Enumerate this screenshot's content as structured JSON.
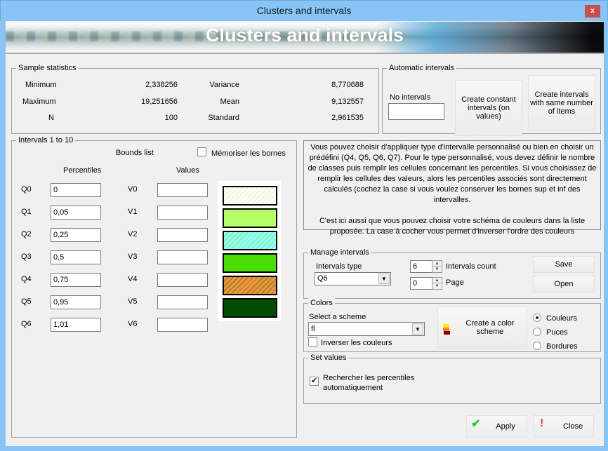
{
  "window": {
    "title": "Clusters and intervals",
    "close_label": "x"
  },
  "banner": {
    "title": "Clusters and intervals"
  },
  "sample_statistics": {
    "legend": "Sample statistics",
    "minimum": {
      "label": "Minimum",
      "value": "2,338256"
    },
    "maximum": {
      "label": "Maximum",
      "value": "19,251656"
    },
    "n": {
      "label": "N",
      "value": "100"
    },
    "variance": {
      "label": "Variance",
      "value": "8,770688"
    },
    "mean": {
      "label": "Mean",
      "value": "9,132557"
    },
    "standard": {
      "label": "Standard",
      "value": "2,961535"
    }
  },
  "automatic_intervals": {
    "legend": "Automatic intervals",
    "no_intervals_label": "No intervals",
    "no_intervals_value": "",
    "constant_button": "Create constant intervals (on values)",
    "same_items_button": "Create intervals with same number of items"
  },
  "intervals": {
    "legend": "Intervals 1 to 10",
    "bounds_list_label": "Bounds list",
    "memorize_label": "Mémoriser les bornes",
    "memorize_checked": false,
    "percentiles_header": "Percentiles",
    "values_header": "Values",
    "rows": [
      {
        "q_label": "Q0",
        "q_value": "0",
        "v_label": "V0",
        "v_value": ""
      },
      {
        "q_label": "Q1",
        "q_value": "0,05",
        "v_label": "V1",
        "v_value": ""
      },
      {
        "q_label": "Q2",
        "q_value": "0,25",
        "v_label": "V2",
        "v_value": ""
      },
      {
        "q_label": "Q3",
        "q_value": "0,5",
        "v_label": "V3",
        "v_value": ""
      },
      {
        "q_label": "Q4",
        "q_value": "0,75",
        "v_label": "V4",
        "v_value": ""
      },
      {
        "q_label": "Q5",
        "q_value": "0,95",
        "v_label": "V5",
        "v_value": ""
      },
      {
        "q_label": "Q6",
        "q_value": "1,01",
        "v_label": "V6",
        "v_value": ""
      }
    ],
    "swatches": [
      {
        "color": "#ffffff",
        "hatch": "#d8f5a0"
      },
      {
        "color": "#b3ff66",
        "hatch": null
      },
      {
        "color": "#88ffff",
        "hatch": "#a6e05a"
      },
      {
        "color": "#4ade00",
        "hatch": null
      },
      {
        "color": "#ff8c3c",
        "hatch": "#3a9a20"
      },
      {
        "color": "#004d00",
        "hatch": null
      }
    ]
  },
  "help_text": {
    "paragraph1": "Vous pouvez choisir d'appliquer type d'intervalle personnalisé ou bien en choisir un prédéfini (Q4, Q5, Q6, Q7). Pour le type personnalisé, vous devez définir le nombre de classes puis remplir les cellules concernant les percentiles. Si vous choisissez de remplir les cellules des valeurs, alors les percentiles associés sont directement calculés (cochez la case si vous voulez conserver les bornes sup et inf des intervalles.",
    "paragraph2": "C'est ici aussi que vous pouvez choisir votre schéma de couleurs dans la liste proposée. La case à cocher vous permet d'inverser l'ordre des couleurs"
  },
  "manage_intervals": {
    "legend": "Manage intervals",
    "type_label": "Intervals type",
    "type_value": "Q6",
    "count_value": "6",
    "count_label": "Intervals count",
    "page_value": "0",
    "page_label": "Page",
    "save_label": "Save",
    "open_label": "Open"
  },
  "colors": {
    "legend": "Colors",
    "scheme_label": "Select a scheme",
    "scheme_value": "fl",
    "invert_label": "Inverser les couleurs",
    "invert_checked": false,
    "create_scheme_label": "Create a color scheme",
    "scheme_icon_colors": [
      "#ffee00",
      "#ff8040",
      "#800000"
    ],
    "radios": [
      {
        "label": "Couleurs",
        "checked": true
      },
      {
        "label": "Puces",
        "checked": false
      },
      {
        "label": "Bordures",
        "checked": false
      }
    ]
  },
  "set_values": {
    "legend": "Set values",
    "auto_percentiles_label": "Rechercher les percentiles automatiquement",
    "auto_percentiles_checked": true
  },
  "footer": {
    "apply_label": "Apply",
    "close_label": "Close"
  }
}
